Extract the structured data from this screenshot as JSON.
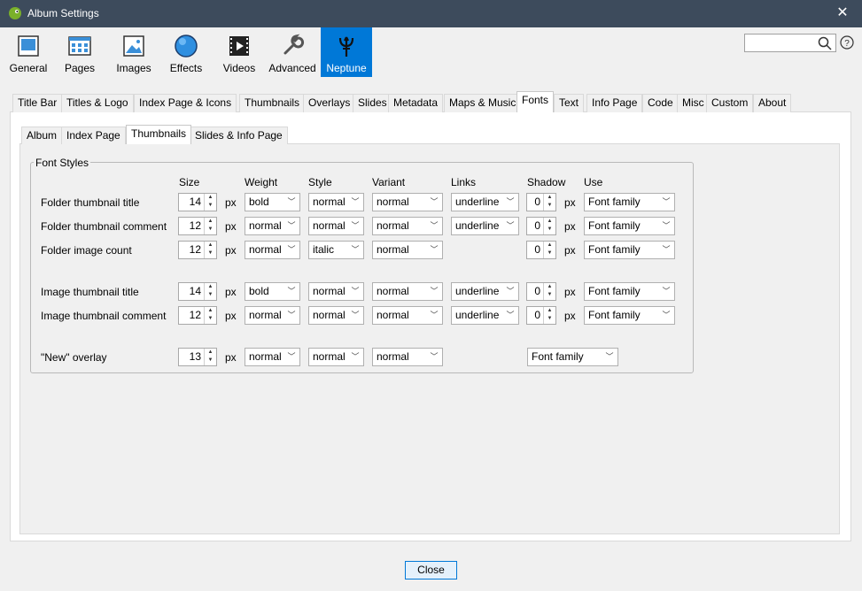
{
  "window": {
    "title": "Album Settings"
  },
  "toolbar": {
    "items": [
      {
        "label": "General",
        "icon": "general-icon"
      },
      {
        "label": "Pages",
        "icon": "pages-icon"
      },
      {
        "label": "Images",
        "icon": "images-icon"
      },
      {
        "label": "Effects",
        "icon": "effects-icon"
      },
      {
        "label": "Videos",
        "icon": "videos-icon"
      },
      {
        "label": "Advanced",
        "icon": "advanced-icon"
      },
      {
        "label": "Neptune",
        "icon": "neptune-icon"
      }
    ],
    "active": "Neptune"
  },
  "search": {
    "value": ""
  },
  "tabs": [
    "Title Bar",
    "Titles & Logo",
    "Index Page & Icons",
    "Thumbnails",
    "Overlays",
    "Slides",
    "Metadata",
    "Maps & Music",
    "Fonts",
    "Text",
    "Info Page",
    "Code",
    "Misc",
    "Custom",
    "About"
  ],
  "active_tab": "Fonts",
  "subtabs": [
    "Album",
    "Index Page",
    "Thumbnails",
    "Slides & Info Page"
  ],
  "active_subtab": "Thumbnails",
  "font_styles": {
    "legend": "Font Styles",
    "headers": {
      "size": "Size",
      "weight": "Weight",
      "style": "Style",
      "variant": "Variant",
      "links": "Links",
      "shadow": "Shadow",
      "use": "Use"
    },
    "unit": "px",
    "rows": [
      {
        "label": "Folder thumbnail title",
        "size": "14",
        "weight": "bold",
        "style": "normal",
        "variant": "normal",
        "links": "underline",
        "shadow": "0",
        "use": "Font family"
      },
      {
        "label": "Folder thumbnail comment",
        "size": "12",
        "weight": "normal",
        "style": "normal",
        "variant": "normal",
        "links": "underline",
        "shadow": "0",
        "use": "Font family"
      },
      {
        "label": "Folder image count",
        "size": "12",
        "weight": "normal",
        "style": "italic",
        "variant": "normal",
        "links": null,
        "shadow": "0",
        "use": "Font family"
      },
      {
        "label": "Image thumbnail title",
        "size": "14",
        "weight": "bold",
        "style": "normal",
        "variant": "normal",
        "links": "underline",
        "shadow": "0",
        "use": "Font family"
      },
      {
        "label": "Image thumbnail comment",
        "size": "12",
        "weight": "normal",
        "style": "normal",
        "variant": "normal",
        "links": "underline",
        "shadow": "0",
        "use": "Font family"
      },
      {
        "label": "\"New\" overlay",
        "size": "13",
        "weight": "normal",
        "style": "normal",
        "variant": "normal",
        "links": null,
        "shadow": null,
        "use": "Font family"
      }
    ]
  },
  "buttons": {
    "close": "Close"
  },
  "colors": {
    "titlebar": "#3d4b5c",
    "accent": "#0078d7"
  }
}
